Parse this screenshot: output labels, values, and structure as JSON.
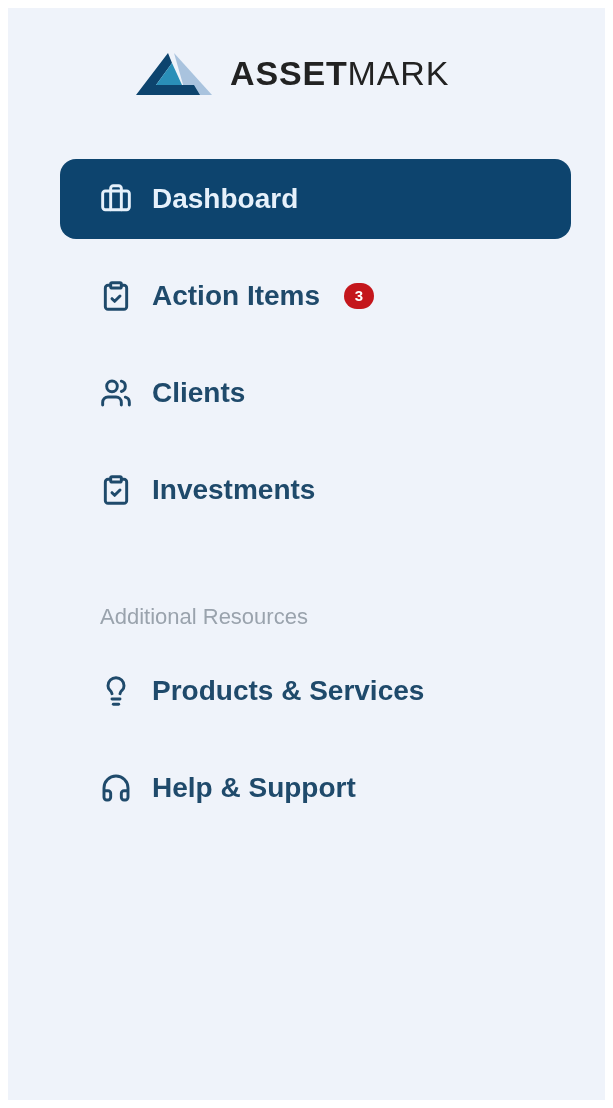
{
  "logo": {
    "wordmark": "**ASSET**MARK"
  },
  "nav": [
    {
      "label": "Dashboard",
      "kind": "briefcase",
      "selected": true
    },
    {
      "label": "Action Items",
      "kind": "checklist",
      "selected": false,
      "badge": "3"
    },
    {
      "label": "Clients",
      "kind": "people",
      "selected": false
    },
    {
      "label": "Investments",
      "kind": "checklist",
      "selected": false
    }
  ],
  "section": {
    "title": "Additional Resources",
    "items": [
      {
        "label": "Products & Services",
        "kind": "bulb",
        "selected": false
      },
      {
        "label": "Help & Support",
        "kind": "headset",
        "selected": false
      }
    ]
  }
}
